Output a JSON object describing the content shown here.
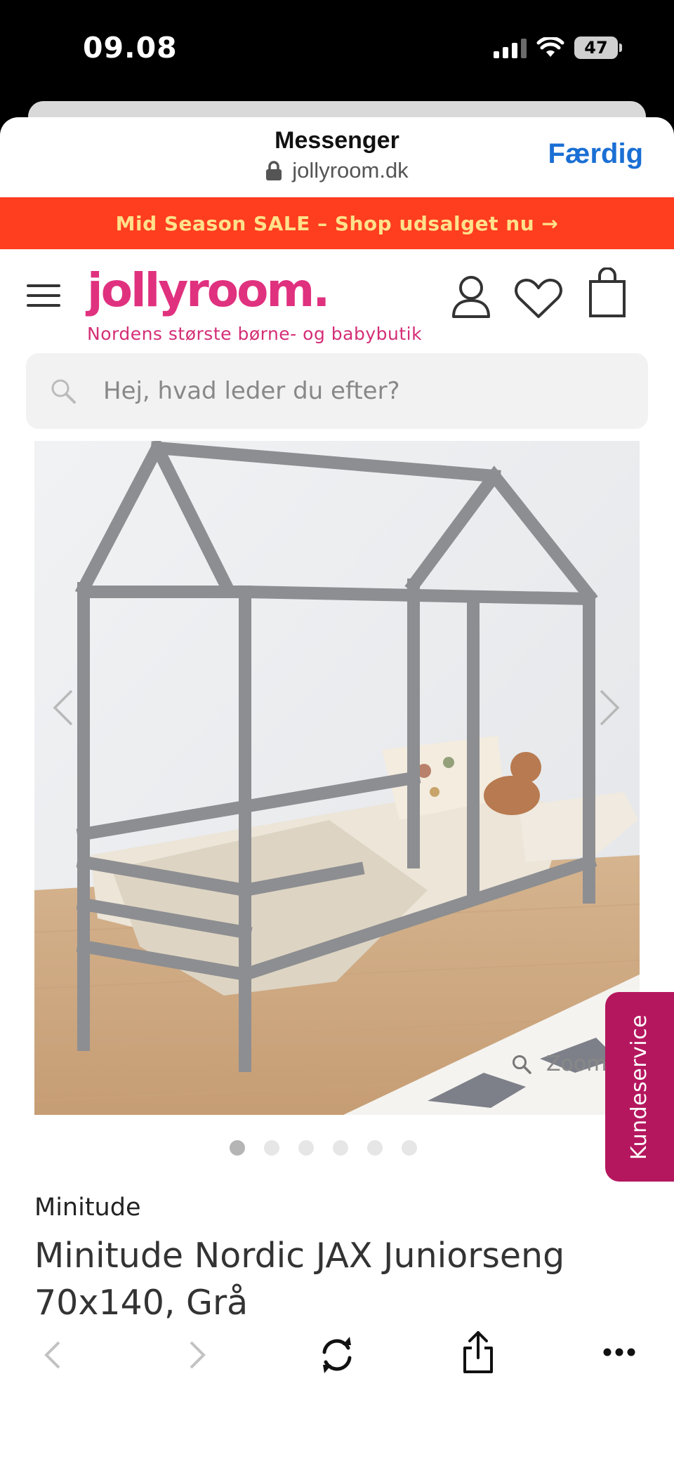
{
  "status_bar": {
    "time": "09.08",
    "battery": "47"
  },
  "sheet": {
    "title": "Messenger",
    "url": "jollyroom.dk",
    "done_label": "Færdig"
  },
  "promo": {
    "text": "Mid Season SALE – Shop udsalget nu →"
  },
  "site": {
    "logo": "jollyroom.",
    "tagline": "Nordens største børne- og babybutik",
    "search_placeholder": "Hej, hvad leder du efter?"
  },
  "gallery": {
    "zoom_label": "Zoom",
    "slide_count": 6,
    "active_slide": 1
  },
  "side_tab": {
    "label": "Kundeservice"
  },
  "product": {
    "brand": "Minitude",
    "title": "Minitude Nordic JAX Juniorseng 70x140, Grå"
  },
  "colors": {
    "promo_bg": "#ff3d1f",
    "promo_text": "#ffe18a",
    "brand_pink": "#e0317f",
    "side_tab_bg": "#b5175f",
    "done_blue": "#1a6fd4"
  },
  "icons": [
    "menu-icon",
    "user-icon",
    "heart-icon",
    "bag-icon",
    "search-icon",
    "chevron-left-icon",
    "chevron-right-icon",
    "zoom-icon",
    "back-icon",
    "forward-icon",
    "reload-icon",
    "share-icon",
    "more-icon",
    "lock-icon"
  ]
}
